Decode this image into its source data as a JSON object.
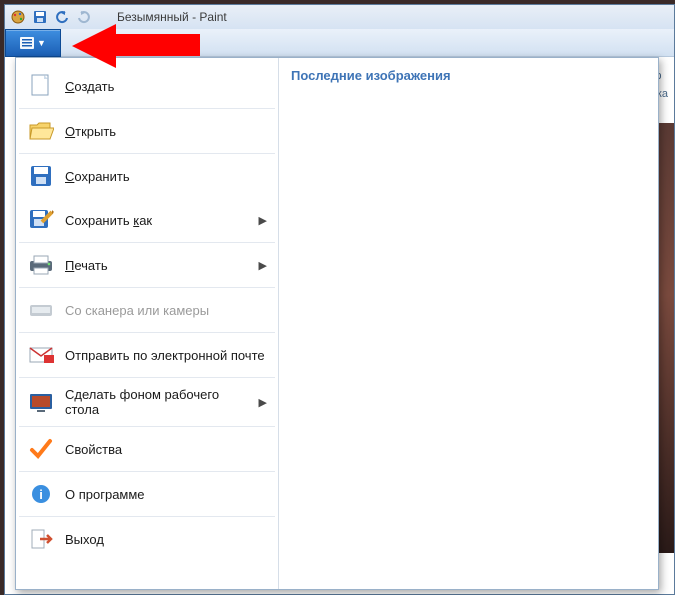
{
  "window": {
    "title": "Безымянный - Paint"
  },
  "ribbon": {
    "hint1": "тур",
    "hint2": "ивка"
  },
  "recent": {
    "heading": "Последние изображения"
  },
  "menu": {
    "create": {
      "label": "Создать",
      "accel": "С"
    },
    "open": {
      "label": "Открыть",
      "accel": "О"
    },
    "save": {
      "label": "Сохранить",
      "accel": "С"
    },
    "saveas": {
      "label": "Сохранить как",
      "accel": "к"
    },
    "print": {
      "label": "Печать",
      "accel": "П"
    },
    "scanner": {
      "label": "Со сканера или камеры"
    },
    "email": {
      "label": "Отправить по электронной почте"
    },
    "wall": {
      "label": "Сделать фоном рабочего стола"
    },
    "props": {
      "label": "Свойства"
    },
    "about": {
      "label": "О программе"
    },
    "exit": {
      "label": "Выход"
    }
  }
}
